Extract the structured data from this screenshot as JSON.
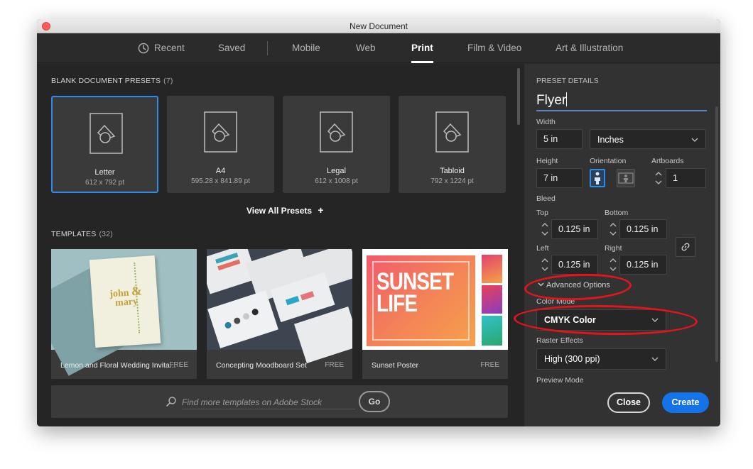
{
  "window": {
    "title": "New Document"
  },
  "tabs": [
    {
      "label": "Recent"
    },
    {
      "label": "Saved"
    },
    {
      "label": "Mobile"
    },
    {
      "label": "Web"
    },
    {
      "label": "Print",
      "active": true
    },
    {
      "label": "Film & Video"
    },
    {
      "label": "Art & Illustration"
    }
  ],
  "presets": {
    "heading": "BLANK DOCUMENT PRESETS",
    "count": "(7)",
    "items": [
      {
        "name": "Letter",
        "size": "612 x 792 pt",
        "selected": true
      },
      {
        "name": "A4",
        "size": "595.28 x 841.89 pt"
      },
      {
        "name": "Legal",
        "size": "612 x 1008 pt"
      },
      {
        "name": "Tabloid",
        "size": "792 x 1224 pt"
      }
    ],
    "view_all": "View All Presets"
  },
  "templates": {
    "heading": "TEMPLATES",
    "count": "(32)",
    "items": [
      {
        "name": "Lemon and Floral Wedding Invita...",
        "badge": "FREE",
        "thumb_text": [
          "john",
          "&",
          "mary"
        ]
      },
      {
        "name": "Concepting Moodboard Set",
        "badge": "FREE"
      },
      {
        "name": "Sunset Poster",
        "badge": "FREE",
        "thumb_text": [
          "SUNSET",
          "LIFE"
        ]
      }
    ],
    "search_placeholder": "Find more templates on Adobe Stock",
    "go_label": "Go"
  },
  "details": {
    "heading": "PRESET DETAILS",
    "name": "Flyer",
    "width_label": "Width",
    "width": "5 in",
    "units": "Inches",
    "height_label": "Height",
    "height": "7 in",
    "orientation_label": "Orientation",
    "orientation": "portrait",
    "artboards_label": "Artboards",
    "artboards": "1",
    "bleed_label": "Bleed",
    "bleed": {
      "top_label": "Top",
      "top": "0.125 in",
      "bottom_label": "Bottom",
      "bottom": "0.125 in",
      "left_label": "Left",
      "left": "0.125 in",
      "right_label": "Right",
      "right": "0.125 in"
    },
    "advanced_options": "Advanced Options",
    "color_mode_label": "Color Mode",
    "color_mode": "CMYK Color",
    "raster_label": "Raster Effects",
    "raster": "High (300 ppi)",
    "preview_label": "Preview Mode",
    "close_label": "Close",
    "create_label": "Create"
  },
  "colors": {
    "accent": "#1473e6",
    "selection": "#2d8ceb",
    "annotation": "#e5141b"
  }
}
